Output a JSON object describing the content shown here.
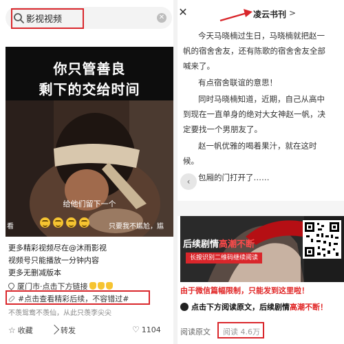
{
  "left": {
    "search": {
      "query": "影视视频"
    },
    "video": {
      "title_line1": "你只管善良",
      "title_line2": "剩下的交给时间",
      "caption": "给他们留下一个",
      "side_left": "看",
      "side_right": "只要我不尴尬，尴",
      "emoji_count": 4
    },
    "description": {
      "line1": "更多精彩视频尽在@沐雨影视",
      "line2": "视频号只能播放一分钟内容",
      "line3": "更多无删减版本"
    },
    "location": "厦门市·点击下方链接",
    "hashtag": "#点击查看精彩后续，不容错过#",
    "comment": "不羡鸳鸯不羡仙，从此只羡李尖尖",
    "actions": {
      "favorite": "收藏",
      "forward": "转发",
      "likes": "1104"
    }
  },
  "right": {
    "header": {
      "title": "凌云书刊",
      "chevron": ">"
    },
    "article": {
      "paragraphs": [
        "今天马晓楠过生日，马晓楠就把赵一",
        "帆的宿舍舍友，还有陈歌的宿舍舍友全部",
        "喊来了。",
        "有点宿舍联谊的意思！",
        "同时马晓楠知道，近期，自己从高中",
        "到现在一直单身的绝对大女神赵一帆，决",
        "定要找一个男朋友了。",
        "赵一帆优雅的喝着果汁，就在这时",
        "候。",
        "包厢的门打开了……"
      ]
    },
    "ad": {
      "title_main": "后续剧情",
      "title_highlight": "高潮不断",
      "banner": "长按识别二维码继续阅读"
    },
    "notice_red": "由于微信篇幅限制，只能发到这里啦！",
    "read_more_prefix": "点击下方阅读原文，后续剧情",
    "read_more_highlight": "高潮不断！",
    "footer": {
      "read_original": "阅读原文",
      "read_count": "阅读 4.6万"
    }
  },
  "colors": {
    "annotation_red": "#d9262b",
    "highlight_red": "#e02424"
  }
}
